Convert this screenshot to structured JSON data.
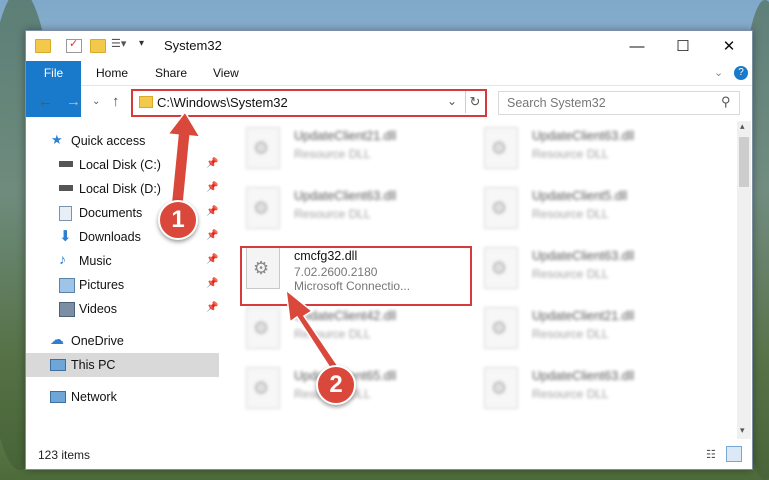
{
  "window": {
    "title": "System32"
  },
  "ribbon": {
    "tabs": [
      "File",
      "Home",
      "Share",
      "View"
    ]
  },
  "address": {
    "path": "C:\\Windows\\System32",
    "search_placeholder": "Search System32"
  },
  "sidebar": {
    "items": [
      {
        "label": "Quick access",
        "icon": "star-icon",
        "pinned": false
      },
      {
        "label": "Local Disk (C:)",
        "icon": "drive-icon",
        "pinned": true
      },
      {
        "label": "Local Disk (D:)",
        "icon": "drive-icon",
        "pinned": true
      },
      {
        "label": "Documents",
        "icon": "documents-icon",
        "pinned": true
      },
      {
        "label": "Downloads",
        "icon": "download-icon",
        "pinned": true
      },
      {
        "label": "Music",
        "icon": "music-icon",
        "pinned": true
      },
      {
        "label": "Pictures",
        "icon": "pictures-icon",
        "pinned": true
      },
      {
        "label": "Videos",
        "icon": "videos-icon",
        "pinned": true
      },
      {
        "label": "OneDrive",
        "icon": "cloud-icon",
        "pinned": false
      },
      {
        "label": "This PC",
        "icon": "pc-icon",
        "pinned": false,
        "selected": true
      },
      {
        "label": "Network",
        "icon": "network-icon",
        "pinned": false
      }
    ]
  },
  "files": [
    {
      "name": "UpdateClient21.dll",
      "desc": "Resource DLL"
    },
    {
      "name": "UpdateClient63.dll",
      "desc": "Resource DLL"
    },
    {
      "name": "UpdateClient63.dll",
      "desc": "Resource DLL"
    },
    {
      "name": "UpdateClient5.dll",
      "desc": "Resource DLL"
    },
    {
      "name": "cmcfg32.dll",
      "desc": "7.02.2600.2180",
      "desc2": "Microsoft Connectio..."
    },
    {
      "name": "UpdateClient63.dll",
      "desc": "Resource DLL"
    },
    {
      "name": "UpdateClient42.dll",
      "desc": "Resource DLL"
    },
    {
      "name": "UpdateClient21.dll",
      "desc": "Resource DLL"
    },
    {
      "name": "UpdateClient65.dll",
      "desc": "Resource DLL"
    },
    {
      "name": "UpdateClient63.dll",
      "desc": "Resource DLL"
    }
  ],
  "status": {
    "count": "123 items"
  },
  "callouts": {
    "one": "1",
    "two": "2"
  },
  "colors": {
    "accent": "#1979ca",
    "highlight": "#d63b3b"
  }
}
